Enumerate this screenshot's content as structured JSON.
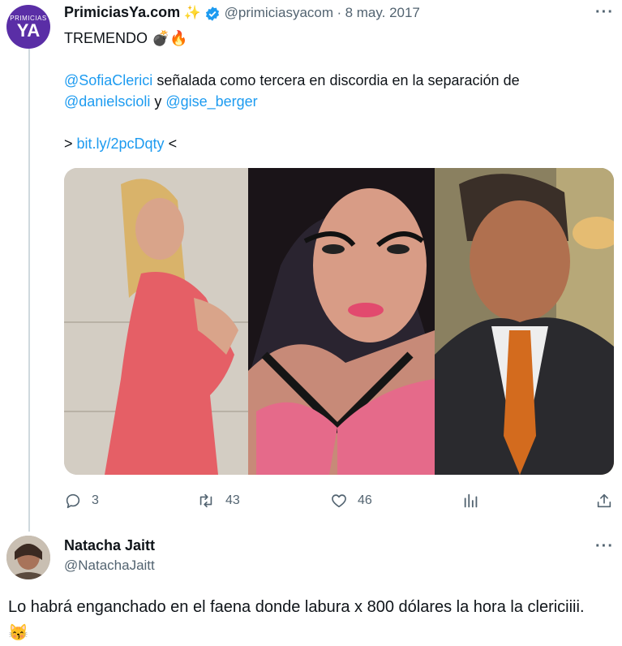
{
  "tweet": {
    "avatar_small": "PRIMICIAS",
    "avatar_big": "YA",
    "display_name": "PrimiciasYa.com",
    "name_emoji": "✨",
    "handle": "@primiciasyacom",
    "separator": "·",
    "date": "8 may. 2017",
    "line1": "TREMENDO 💣🔥",
    "mention1": "@SofiaClerici",
    "line2_text": " señalada como tercera en discordia en la separación de",
    "mention2": "@danielscioli",
    "conj": " y ",
    "mention3": "@gise_berger",
    "link_prefix": "> ",
    "link": "bit.ly/2pcDqty",
    "link_suffix": " <",
    "replies": "3",
    "retweets": "43",
    "likes": "46",
    "more": "···"
  },
  "reply": {
    "display_name": "Natacha Jaitt",
    "handle": "@NatachaJaitt",
    "text": "Lo habrá enganchado en el faena donde labura x 800 dólares la hora la clericiiii.😽",
    "more": "···"
  },
  "colors": {
    "link": "#1d9bf0",
    "verified": "#1d9bf0",
    "thread_line": "#cfd9de",
    "avatar_brand": "#5a2ea6"
  },
  "icons": [
    "reply-icon",
    "retweet-icon",
    "like-icon",
    "views-icon",
    "share-icon",
    "verified-badge-icon",
    "more-icon"
  ]
}
